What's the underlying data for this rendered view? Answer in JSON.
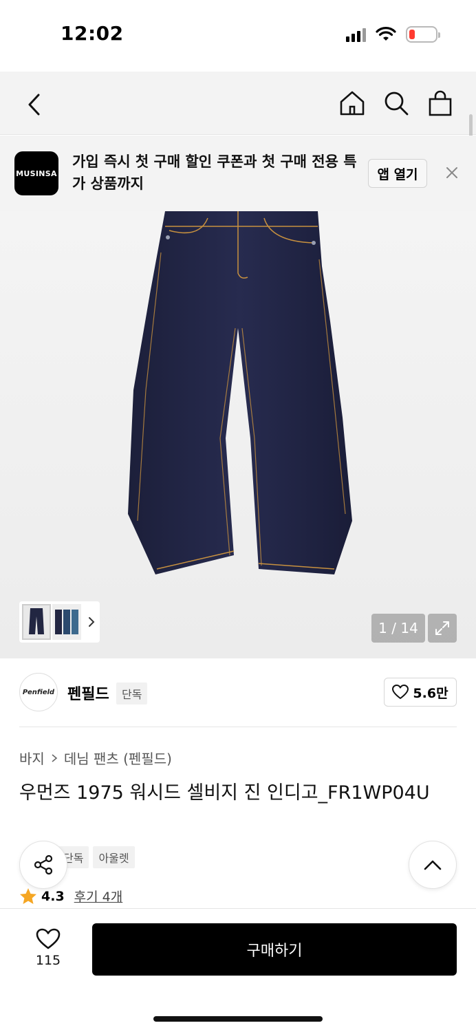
{
  "status_bar": {
    "time": "12:02"
  },
  "banner": {
    "logo_text": "MUSINSA",
    "message": "가입 즉시 첫 구매 할인 쿠폰과 첫 구매 전용 특가 상품까지",
    "open_app_label": "앱 열기"
  },
  "gallery": {
    "counter": "1 / 14"
  },
  "brand": {
    "logo_text": "Penfield",
    "name": "펜필드",
    "tag": "단독",
    "likes": "5.6만"
  },
  "product": {
    "breadcrumb": [
      "바지",
      "데님 팬츠 (펜필드)"
    ],
    "title": "우먼즈 1975 워시드 셀비지 진 인디고_FR1WP04U",
    "tags": [
      "단독",
      "아울렛"
    ],
    "rating": "4.3",
    "reviews": "후기 4개"
  },
  "bottom_bar": {
    "wish_count": "115",
    "buy_label": "구매하기"
  },
  "colors": {
    "accent": "#000000",
    "star": "#f5a623",
    "battery_low": "#ff3b30"
  }
}
